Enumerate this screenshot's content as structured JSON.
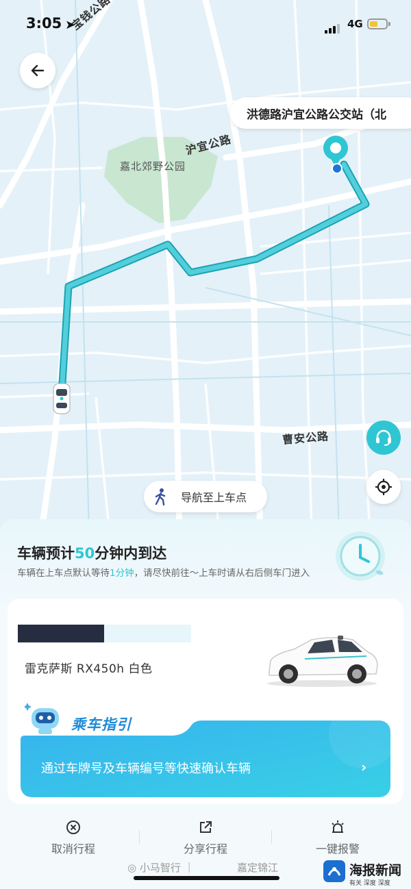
{
  "status_bar": {
    "time": "3:05",
    "network": "4G",
    "battery_color": "#f4c430"
  },
  "map": {
    "destination": "洪德路沪宜公路公交站（北",
    "road_labels": {
      "baoqian": "宝钱公路",
      "huyi": "沪宜公路",
      "park": "嘉北郊野公园",
      "caoan": "曹安公路"
    },
    "walk_pill": "导航至上车点",
    "route_color": "#4ec9d6"
  },
  "sheet": {
    "eta_prefix": "车辆预计",
    "eta_minutes": "50",
    "eta_suffix": "分钟内到达",
    "sub_a": "车辆在上车点默认等待",
    "sub_wait": "1分钟",
    "sub_b": "，请尽快前往～上车时请从右后侧车门进入",
    "vehicle": "雷克萨斯 RX450h 白色",
    "guide_title": "乘车指引",
    "guide_text": "通过车牌号及车辆编号等快速确认车辆"
  },
  "actions": [
    {
      "label": "取消行程",
      "icon": "cancel-icon"
    },
    {
      "label": "分享行程",
      "icon": "share-icon"
    },
    {
      "label": "一键报警",
      "icon": "alarm-icon"
    }
  ],
  "footer": {
    "brand1": "小马智行",
    "brand2": "嘉定锦江"
  },
  "watermark": {
    "title": "海报新闻",
    "sub": "有关 深度 深度"
  }
}
